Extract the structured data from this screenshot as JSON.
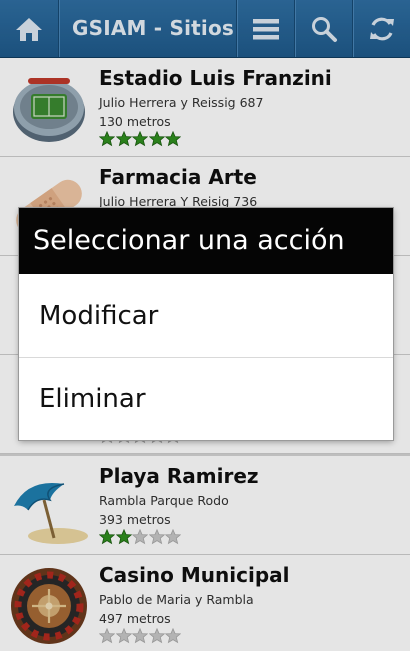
{
  "action_bar": {
    "title": "GSIAM - Sitios",
    "icons": [
      "home-icon",
      "menu-icon",
      "search-icon",
      "refresh-icon"
    ],
    "color": "#2565a0"
  },
  "places": [
    {
      "name": "Estadio Luis Franzini",
      "address": "Julio Herrera y Reissig 687",
      "distance": "130 metros",
      "rating": 5,
      "icon": "stadium-icon"
    },
    {
      "name": "Farmacia Arte",
      "address": "Julio Herrera Y Reisig 736",
      "distance": "",
      "rating": 0,
      "icon": "bandage-icon"
    },
    {
      "name": "",
      "address": "",
      "distance": "",
      "rating": 0,
      "icon": ""
    },
    {
      "name": "",
      "address": "",
      "distance": "",
      "rating": 0,
      "icon": ""
    },
    {
      "name": "Playa Ramirez",
      "address": "Rambla Parque Rodo",
      "distance": "393 metros",
      "rating": 2,
      "icon": "beach-umbrella-icon"
    },
    {
      "name": "Casino Municipal",
      "address": "Pablo de Maria y Rambla",
      "distance": "497 metros",
      "rating": 0,
      "icon": "roulette-icon"
    }
  ],
  "dialog": {
    "title": "Seleccionar una acción",
    "options": [
      "Modificar",
      "Eliminar"
    ]
  },
  "star_colors": {
    "filled": "#2f8f1f",
    "empty": "#c8c8c8"
  }
}
